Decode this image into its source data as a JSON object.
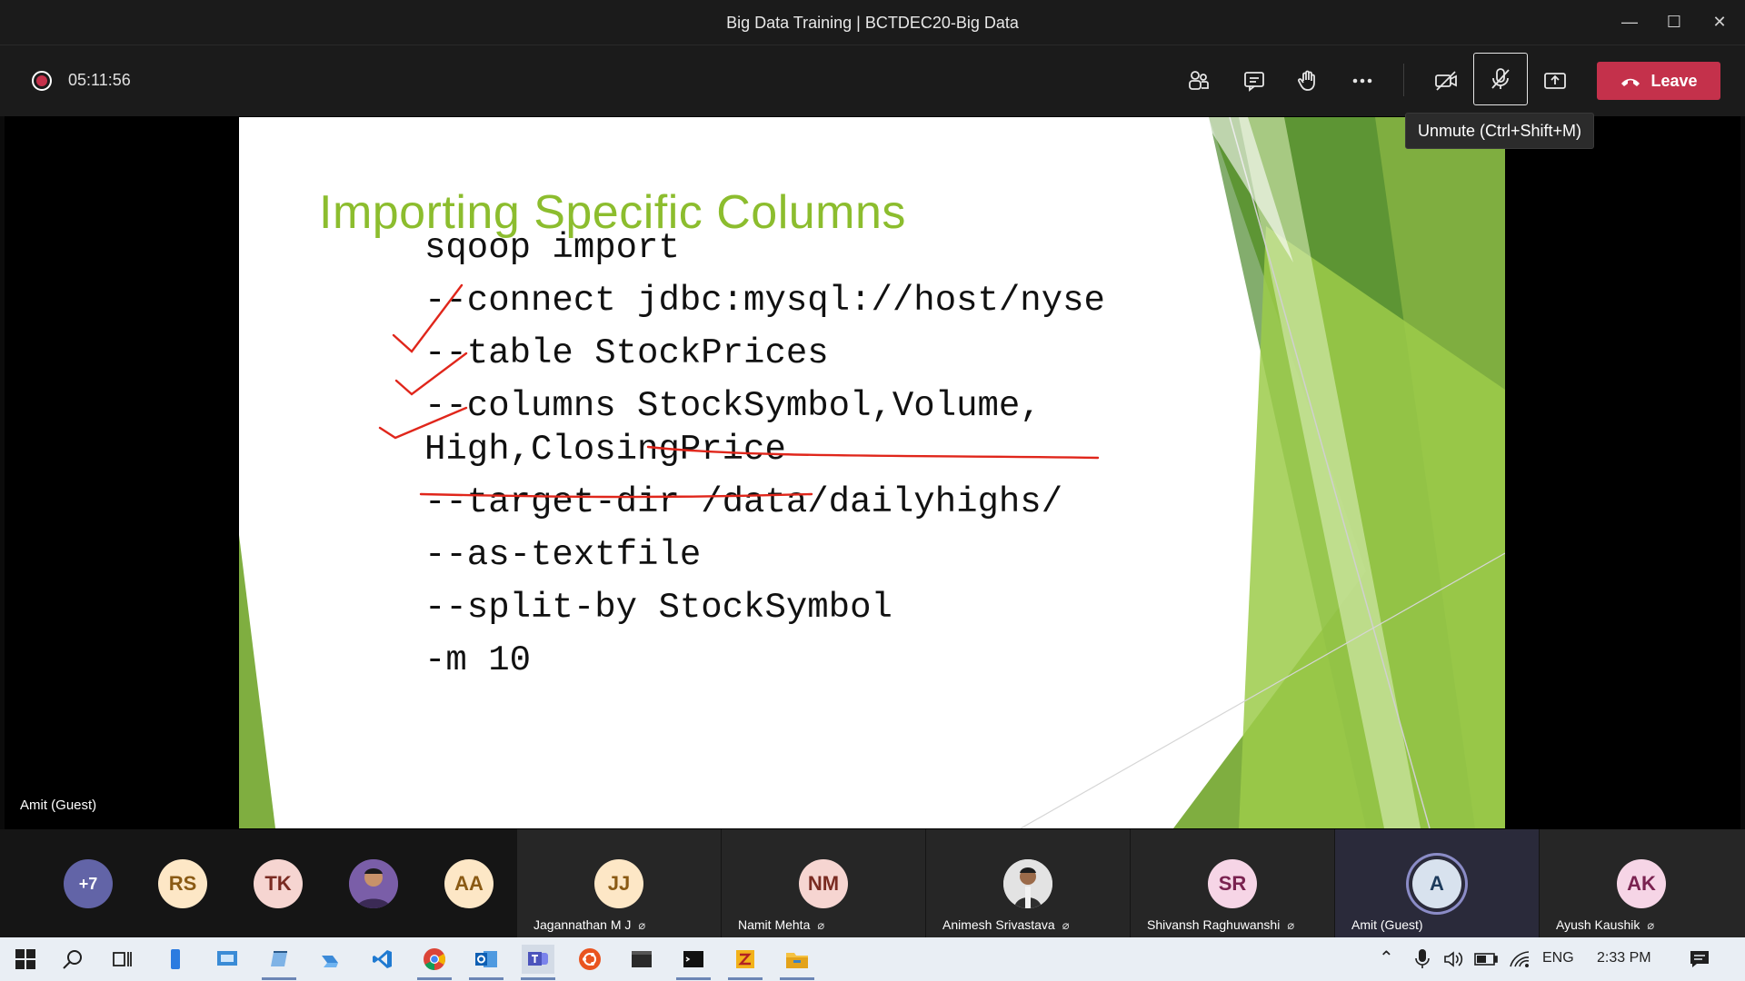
{
  "window": {
    "title": "Big Data Training | BCTDEC20-Big Data",
    "controls": [
      "minimize-icon",
      "maximize-icon",
      "close-icon"
    ]
  },
  "toolbar": {
    "timer": "05:11:56",
    "leave_label": "Leave",
    "mic_tooltip": "Unmute (Ctrl+Shift+M)",
    "icons": [
      "participants-icon",
      "chat-icon",
      "raise-hand-icon",
      "more-icon",
      "camera-off-icon",
      "mic-off-icon",
      "share-icon"
    ],
    "leave_color": "#c4314b"
  },
  "slide": {
    "title": "Importing Specific Columns",
    "title_color": "#8cbd2e",
    "lines": [
      "sqoop import",
      "--connect jdbc:mysql://host/nyse",
      "--table StockPrices",
      "--columns StockSymbol,Volume,",
      "High,ClosingPrice",
      "--target-dir /data/dailyhighs/",
      "--as-textfile",
      "--split-by StockSymbol",
      "-m 10"
    ],
    "annotation_color": "#e0261b"
  },
  "stage": {
    "presenter_name": "Amit (Guest)"
  },
  "participants": {
    "overflow": "+7",
    "small": [
      {
        "initials": "RS",
        "bg": "#fde7c6",
        "fg": "#8a5a14"
      },
      {
        "initials": "TK",
        "bg": "#f6d5d1",
        "fg": "#7a2b22"
      },
      {
        "initials": "",
        "bg": "#4a3b6b",
        "fg": "#fff"
      },
      {
        "initials": "AA",
        "bg": "#fde7c6",
        "fg": "#8a5a14"
      }
    ],
    "tiles": [
      {
        "initials": "JJ",
        "name": "Jagannathan M J",
        "bg": "#fde7c6",
        "fg": "#8a5a14"
      },
      {
        "initials": "NM",
        "name": "Namit Mehta",
        "bg": "#f6d5d1",
        "fg": "#7a2b22"
      },
      {
        "initials": "",
        "name": "Animesh Srivastava",
        "bg": "#d9d9d9",
        "fg": "#333"
      },
      {
        "initials": "SR",
        "name": "Shivansh Raghuwanshi",
        "bg": "#f6d5e6",
        "fg": "#7a2250"
      },
      {
        "initials": "A",
        "name": "Amit (Guest)",
        "bg": "#d8e2ee",
        "fg": "#1d3b5c"
      },
      {
        "initials": "AK",
        "name": "Ayush Kaushik",
        "bg": "#f6d5e6",
        "fg": "#7a2250"
      }
    ]
  },
  "taskbar": {
    "lang": "ENG",
    "time": "2:33 PM"
  }
}
